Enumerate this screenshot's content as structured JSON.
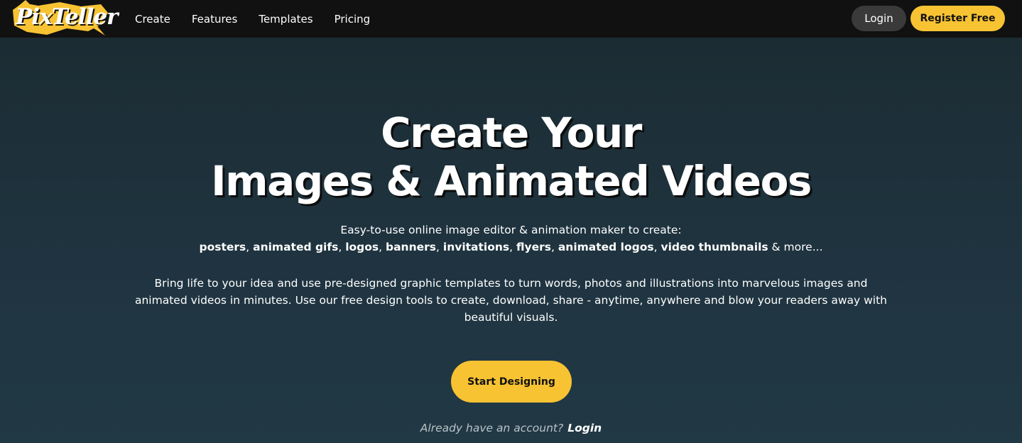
{
  "brand": {
    "logo_text": "PixTeller",
    "brush_color": "#f8c332"
  },
  "nav": {
    "items": [
      {
        "label": "Create"
      },
      {
        "label": "Features"
      },
      {
        "label": "Templates"
      },
      {
        "label": "Pricing"
      }
    ]
  },
  "auth": {
    "login_label": "Login",
    "register_label": "Register Free"
  },
  "hero": {
    "headline_line1": "Create Your",
    "headline_line2": "Images & Animated Videos",
    "subtitle": "Easy-to-use online image editor & animation maker to create:",
    "use_cases": [
      "posters",
      "animated gifs",
      "logos",
      "banners",
      "invitations",
      "flyers",
      "animated logos",
      "video thumbnails"
    ],
    "use_cases_suffix": "& more...",
    "description": "Bring life to your idea and use pre-designed graphic templates to turn words, photos and illustrations into marvelous images and animated videos in minutes. Use our free design tools to create, download, share - anytime, anywhere and blow your readers away with beautiful visuals.",
    "cta_label": "Start Designing",
    "already_text": "Already have an account?",
    "already_login_label": "Login"
  },
  "colors": {
    "accent": "#f8c332",
    "topbar": "#111111",
    "hero_bg": "#1f3139"
  }
}
